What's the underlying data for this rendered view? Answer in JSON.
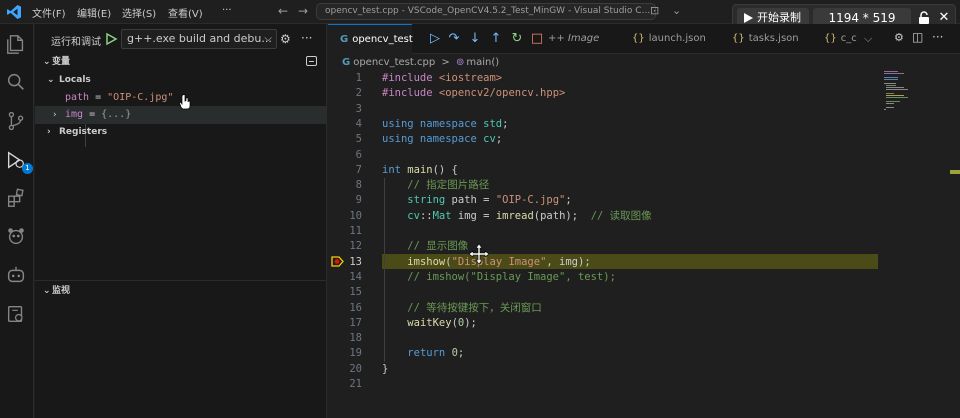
{
  "titlebar": {
    "menus": [
      "文件(F)",
      "编辑(E)",
      "选择(S)",
      "查看(V)"
    ],
    "title": "opencv_test.cpp - VSCode_OpenCV4.5.2_Test_MinGW - Visual Studio C..."
  },
  "recorder": {
    "start_label": "开始录制",
    "size": "1194 * 519"
  },
  "activity": {
    "debug_badge": "1"
  },
  "sidebar": {
    "title": "运行和调试",
    "config": "g++.exe build and debu...",
    "variables_section": "变量",
    "locals_label": "Locals",
    "vars": [
      {
        "name": "path",
        "eq": " = ",
        "value": "\"OIP-C.jpg\""
      },
      {
        "name": "img",
        "eq": " = ",
        "value": "{...}"
      }
    ],
    "registers_label": "Registers",
    "watch_section": "监视"
  },
  "editor": {
    "tabs": [
      {
        "label": "opencv_test"
      },
      {
        "label": "++ Image"
      },
      {
        "label": "launch.json"
      },
      {
        "label": "tasks.json"
      },
      {
        "label": "c_c"
      }
    ],
    "breadcrumb": {
      "file": "opencv_test.cpp",
      "sep": ">",
      "symbol": "main()"
    },
    "current_line": 13,
    "lines": [
      {
        "n": "1"
      },
      {
        "n": "2"
      },
      {
        "n": "3"
      },
      {
        "n": "4"
      },
      {
        "n": "5"
      },
      {
        "n": "6"
      },
      {
        "n": "7"
      },
      {
        "n": "8"
      },
      {
        "n": "9"
      },
      {
        "n": "10"
      },
      {
        "n": "11"
      },
      {
        "n": "12"
      },
      {
        "n": "13"
      },
      {
        "n": "14"
      },
      {
        "n": "15"
      },
      {
        "n": "16"
      },
      {
        "n": "17"
      },
      {
        "n": "18"
      },
      {
        "n": "19"
      },
      {
        "n": "20"
      },
      {
        "n": "21"
      }
    ],
    "code": {
      "l1a": "#include ",
      "l1b": "<iostream>",
      "l2a": "#include ",
      "l2b": "<opencv2/opencv.hpp>",
      "l4a": "using namespace ",
      "l4b": "std",
      "l5a": "using namespace ",
      "l5b": "cv",
      "l7a": "int ",
      "l7b": "main",
      "l7c": "() {",
      "l8": "    // 指定图片路径",
      "l9a": "    ",
      "l9b": "string",
      "l9c": " path = ",
      "l9d": "\"OIP-C.jpg\"",
      "l10a": "    ",
      "l10b": "cv",
      "l10c": "::",
      "l10d": "Mat",
      "l10e": " img = ",
      "l10f": "imread",
      "l10g": "(path);  ",
      "l10h": "// 读取图像",
      "l12": "    // 显示图像",
      "l13a": "    ",
      "l13b": "imshow",
      "l13c": "(",
      "l13d": "\"Display Image\"",
      "l13e": ", img);",
      "l14": "    // imshow(\"Display Image\", test);",
      "l16": "    // 等待按键按下，关闭窗口",
      "l17a": "    ",
      "l17b": "waitKey",
      "l17c": "(",
      "l17d": "0",
      "l17e": ");",
      "l19a": "    ",
      "l19b": "return ",
      "l19c": "0",
      "l19d": ";",
      "l20": "}"
    }
  }
}
